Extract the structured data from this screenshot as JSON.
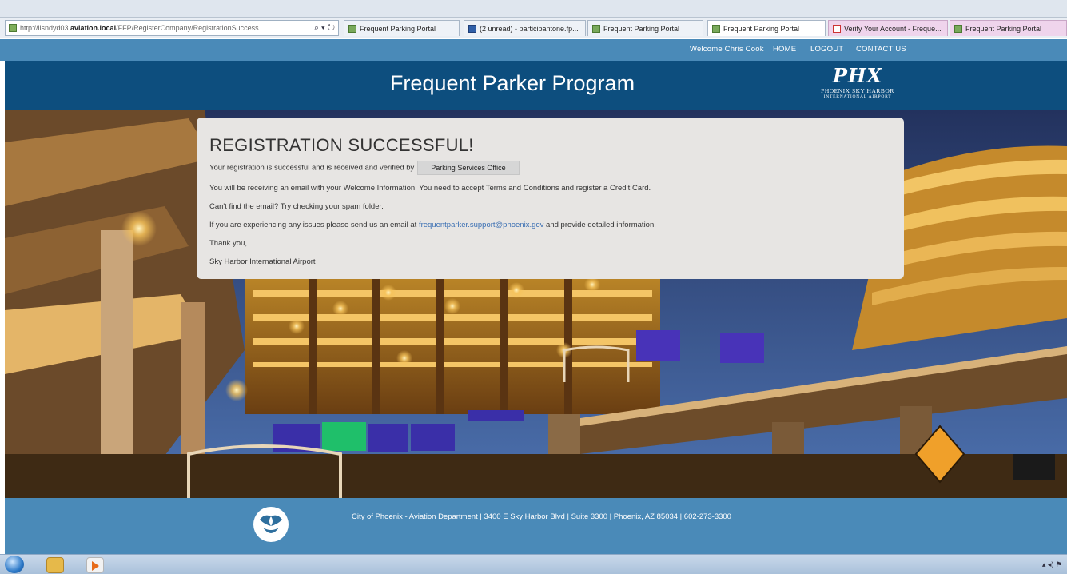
{
  "browser": {
    "url_prefix": "http://iisndyd03.",
    "url_host": "aviation.local",
    "url_path": "/FFP/RegisterCompany/RegistrationSuccess",
    "search_glyph": "⌕ ▾ ↻",
    "tabs": [
      {
        "label": "Frequent Parking Portal"
      },
      {
        "label": "(2 unread) - participantone.fp..."
      },
      {
        "label": "Frequent Parking Portal"
      },
      {
        "label": "Frequent Parking Portal"
      },
      {
        "label": "Verify Your Account - Freque..."
      },
      {
        "label": "Frequent Parking Portal"
      }
    ]
  },
  "nav": {
    "welcome": "Welcome Chris Cook",
    "home": "HOME",
    "logout": "LOGOUT",
    "contact": "CONTACT US"
  },
  "header": {
    "title": "Frequent Parker Program",
    "logo_mark": "PHX",
    "logo_line1": "PHOENIX SKY HARBOR",
    "logo_line2": "INTERNATIONAL AIRPORT"
  },
  "card": {
    "title": "REGISTRATION SUCCESSFUL!",
    "line1": "Your registration is successful and is received and verified by",
    "verifier": "Parking Services Office",
    "line2": "You will be receiving an email with your Welcome Information. You need to accept Terms and Conditions and register a Credit Card.",
    "line3": "Can't find the email? Try checking your spam folder.",
    "line4_pre": "If you are experiencing any issues please send us an email at",
    "email": "frequentparker.support@phoenix.gov",
    "line4_post": "and provide detailed information.",
    "thanks": "Thank you,",
    "signature": "Sky Harbor International Airport"
  },
  "footer": {
    "text": "City of Phoenix - Aviation Department | 3400 E Sky Harbor Blvd | Suite 3300 | Phoenix, AZ 85034 | 602-273-3300"
  },
  "taskbar": {
    "tray": "▴ ◂) ⚑"
  },
  "colors": {
    "nav": "#4a8ab8",
    "header": "#0d4e7e",
    "card": "#e7e5e3",
    "link": "#3a6fb3"
  }
}
